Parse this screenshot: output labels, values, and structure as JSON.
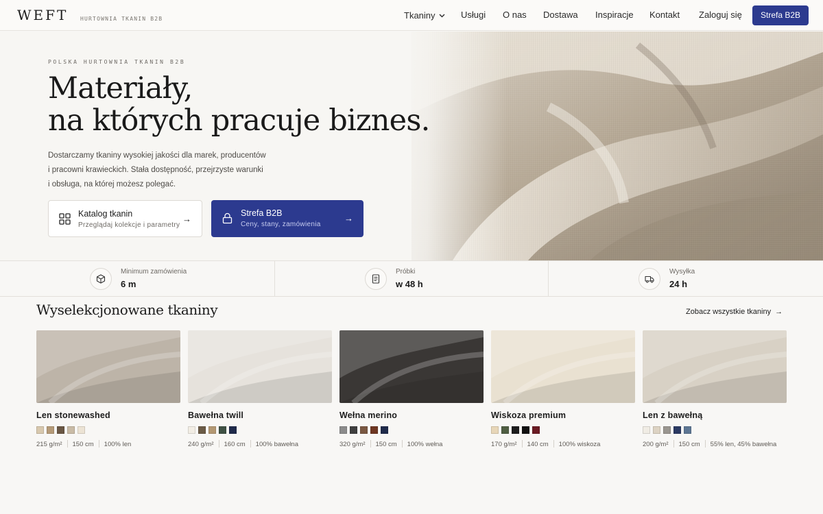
{
  "header": {
    "logo": "WEFT",
    "tagline": "HURTOWNIA TKANIN B2B",
    "nav": [
      {
        "label": "Tkaniny",
        "dropdown": true
      },
      {
        "label": "Usługi"
      },
      {
        "label": "O nas"
      },
      {
        "label": "Dostawa"
      },
      {
        "label": "Inspiracje"
      },
      {
        "label": "Kontakt"
      }
    ],
    "login_label": "Zaloguj się",
    "b2b_button_label": "Strefa B2B"
  },
  "hero": {
    "eyebrow": "POLSKA HURTOWNIA TKANIN B2B",
    "headline_line1": "Materiały,",
    "headline_line2": "na których pracuje biznes.",
    "lead_lines": [
      "Dostarczamy tkaniny wysokiej jakości dla marek, producentów",
      "i pracowni krawieckich. Stała dostępność, przejrzyste warunki",
      "i obsługa, na której możesz polegać."
    ],
    "cta_catalog": {
      "title": "Katalog tkanin",
      "subtitle": "Przeglądaj kolekcje i parametry",
      "icon": "grid-icon",
      "arrow": "→"
    },
    "cta_b2b": {
      "title": "Strefa B2B",
      "subtitle": "Ceny, stany, zamówienia",
      "icon": "lock-icon",
      "arrow": "→"
    }
  },
  "stats": [
    {
      "label": "Minimum zamówienia",
      "value": "6 m",
      "icon": "box-icon"
    },
    {
      "label": "Próbki",
      "value": "w 48 h",
      "icon": "document-icon"
    },
    {
      "label": "Wysyłka",
      "value": "24 h",
      "icon": "truck-icon"
    }
  ],
  "products_section": {
    "title": "Wyselekcjonowane tkaniny",
    "see_all": "Zobacz wszystkie tkaniny",
    "see_all_arrow": "→",
    "products": [
      {
        "name": "Len stonewashed",
        "swatches": [
          "#d8c8ae",
          "#b59a78",
          "#6a5744",
          "#c9bba6",
          "#ece3d4"
        ],
        "specs": [
          "215 g/m²",
          "150 cm",
          "100% len"
        ],
        "tone": "#bdb4a8"
      },
      {
        "name": "Bawełna twill",
        "swatches": [
          "#f2ede4",
          "#6b5b46",
          "#b39873",
          "#3f5144",
          "#1f2a4a"
        ],
        "specs": [
          "240 g/m²",
          "160 cm",
          "100% bawełna"
        ],
        "tone": "#e6e2dc"
      },
      {
        "name": "Wełna merino",
        "swatches": [
          "#8b8b8b",
          "#3f3f3f",
          "#7a5842",
          "#6e3622",
          "#1f2a4a"
        ],
        "specs": [
          "320 g/m²",
          "150 cm",
          "100% wełna"
        ],
        "tone": "#3a3735"
      },
      {
        "name": "Wiskoza premium",
        "swatches": [
          "#e7d6b8",
          "#4f5e42",
          "#1c1c1c",
          "#111111",
          "#6b1c24"
        ],
        "specs": [
          "170 g/m²",
          "140 cm",
          "100% wiskoza"
        ],
        "tone": "#e9e1d1"
      },
      {
        "name": "Len z bawełną",
        "swatches": [
          "#f0ece4",
          "#ddd3c3",
          "#9a9690",
          "#2b3a63",
          "#5d7693"
        ],
        "specs": [
          "200 g/m²",
          "150 cm",
          "55% len, 45% bawełna"
        ],
        "tone": "#d8d1c5"
      }
    ]
  }
}
